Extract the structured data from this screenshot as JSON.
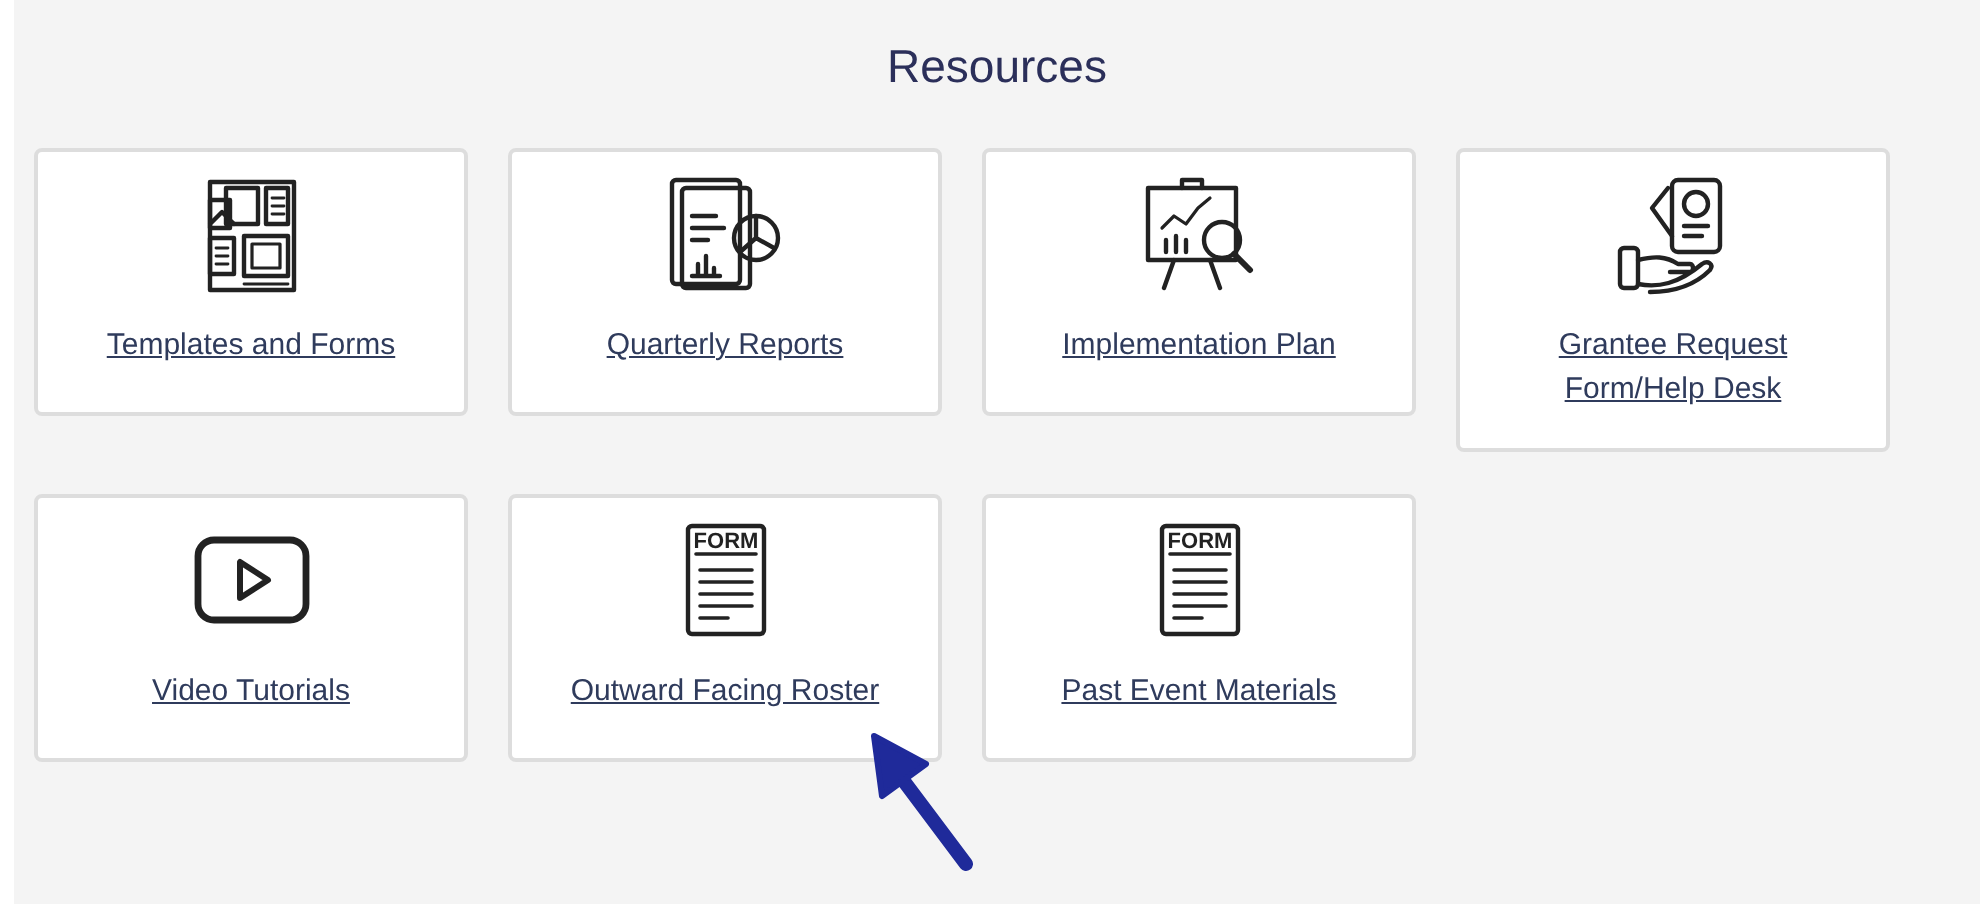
{
  "title": "Resources",
  "resources": [
    {
      "label": "Templates and Forms"
    },
    {
      "label": "Quarterly Reports"
    },
    {
      "label": "Implementation Plan"
    },
    {
      "label": "Grantee Request Form/Help Desk"
    },
    {
      "label": "Video Tutorials"
    },
    {
      "label": "Outward Facing Roster",
      "icon_text": "FORM"
    },
    {
      "label": "Past Event Materials",
      "icon_text": "FORM"
    }
  ]
}
